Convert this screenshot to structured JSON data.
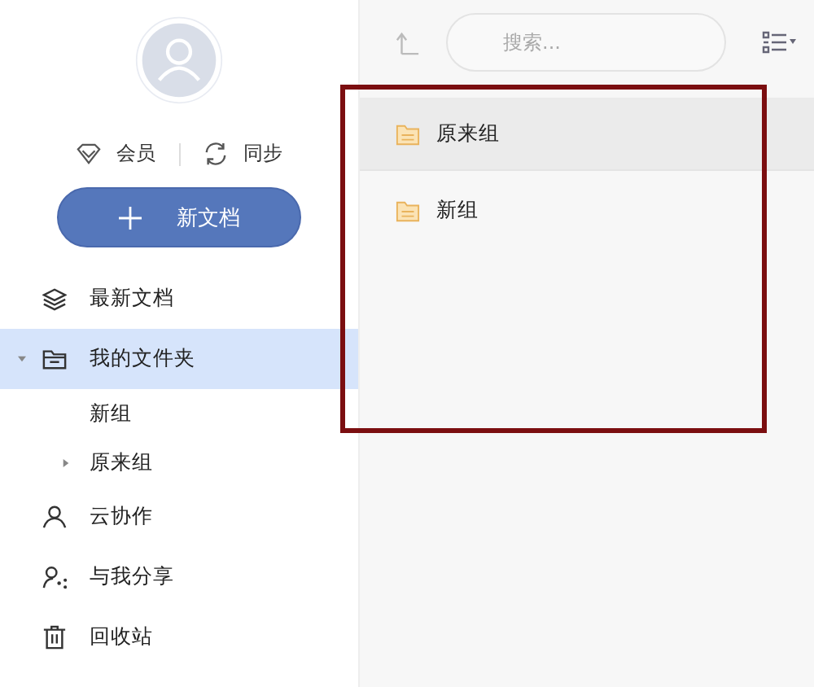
{
  "sidebar": {
    "actions": [
      {
        "kind": "member",
        "label": "会员"
      },
      {
        "kind": "sync",
        "label": "同步"
      }
    ],
    "new_button": "新文档",
    "nav": [
      {
        "kind": "recent",
        "label": "最新文档",
        "selected": false
      },
      {
        "kind": "folder",
        "label": "我的文件夹",
        "selected": true,
        "expanded": true,
        "children": [
          {
            "label": "新组",
            "has_children": false
          },
          {
            "label": "原来组",
            "has_children": true
          }
        ]
      },
      {
        "kind": "collab",
        "label": "云协作",
        "selected": false
      },
      {
        "kind": "shared",
        "label": "与我分享",
        "selected": false
      },
      {
        "kind": "trash",
        "label": "回收站",
        "selected": false
      }
    ]
  },
  "toolbar": {
    "search": {
      "placeholder": "搜索..."
    }
  },
  "files": [
    {
      "name": "原来组",
      "selected": true
    },
    {
      "name": "新组",
      "selected": false
    }
  ]
}
